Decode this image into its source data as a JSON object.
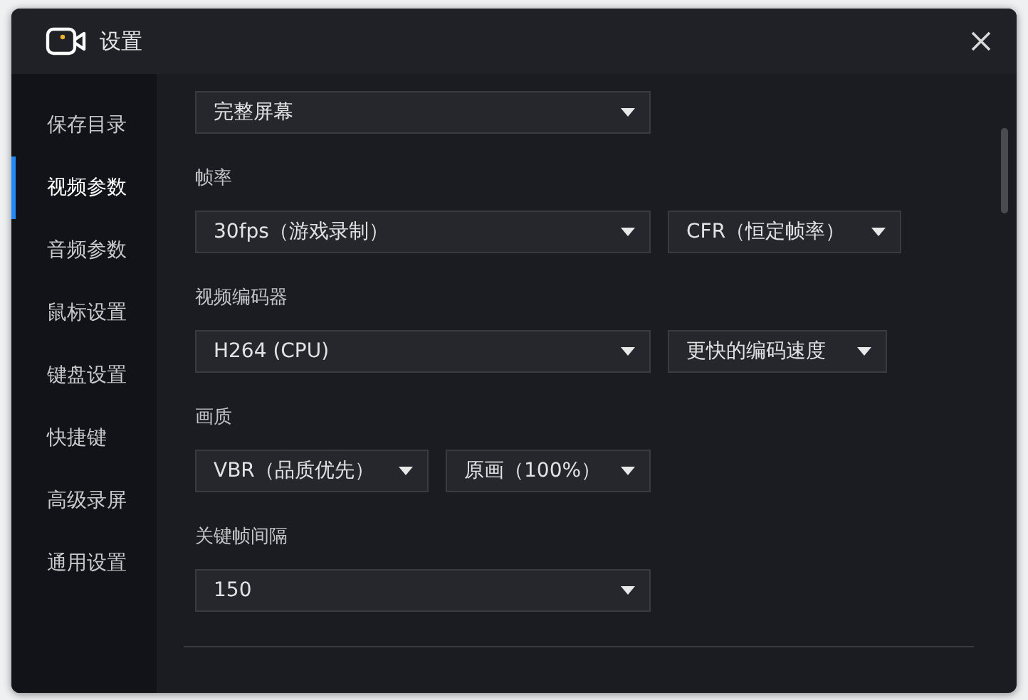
{
  "window": {
    "title": "设置"
  },
  "sidebar": {
    "items": [
      {
        "label": "保存目录",
        "selected": false
      },
      {
        "label": "视频参数",
        "selected": true
      },
      {
        "label": "音频参数",
        "selected": false
      },
      {
        "label": "鼠标设置",
        "selected": false
      },
      {
        "label": "键盘设置",
        "selected": false
      },
      {
        "label": "快捷键",
        "selected": false
      },
      {
        "label": "高级录屏",
        "selected": false
      },
      {
        "label": "通用设置",
        "selected": false
      }
    ]
  },
  "fields": [
    {
      "selects": [
        "完整屏幕"
      ]
    },
    {
      "label": "帧率",
      "selects": [
        "30fps（游戏录制）",
        "CFR（恒定帧率）"
      ]
    },
    {
      "label": "视频编码器",
      "selects": [
        "H264 (CPU)",
        "更快的编码速度"
      ]
    },
    {
      "label": "画质",
      "selects": [
        "VBR（品质优先）",
        "原画（100%）"
      ]
    },
    {
      "label": "关键帧间隔",
      "selects": [
        "150"
      ]
    }
  ]
}
